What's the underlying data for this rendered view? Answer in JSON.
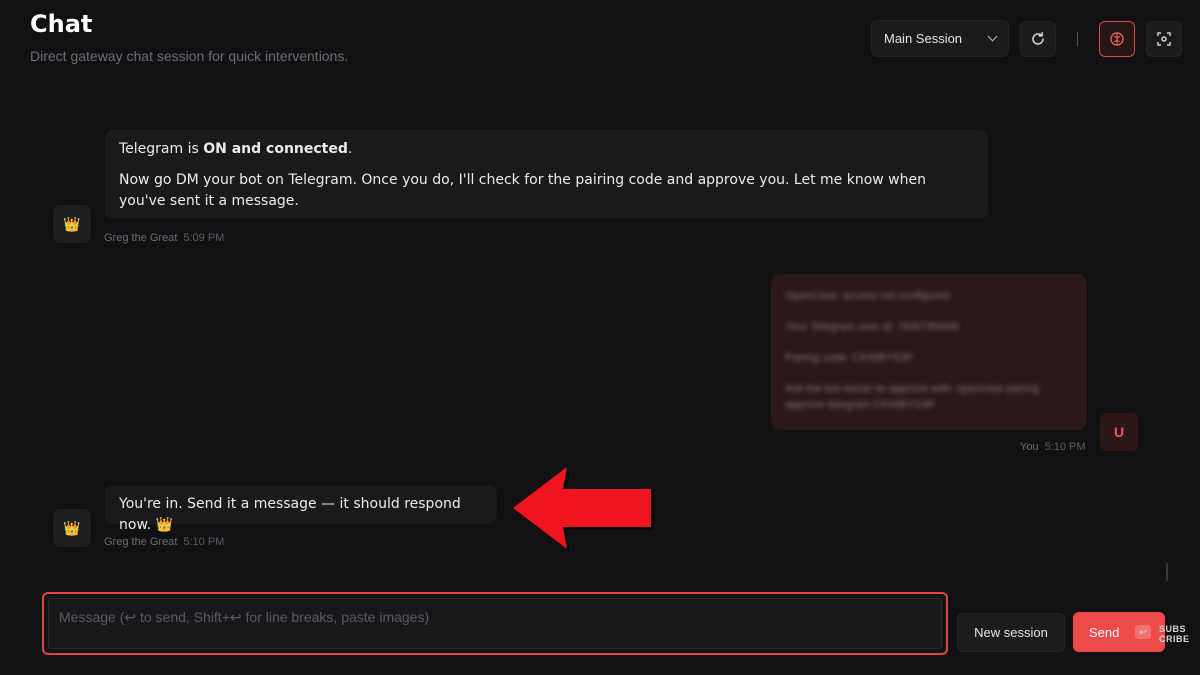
{
  "header": {
    "title": "Chat",
    "subtitle": "Direct gateway chat session for quick interventions."
  },
  "toolbar": {
    "session_select": "Main Session",
    "icons": [
      "refresh-icon",
      "brain-icon",
      "focus-icon"
    ]
  },
  "messages": [
    {
      "sender": "Greg the Great",
      "time": "5:09 PM",
      "avatar": "👑",
      "line1_prefix": "Telegram is ",
      "line1_bold": "ON and connected",
      "line1_suffix": ".",
      "line2": "Now go DM your bot on Telegram. Once you do, I'll check for the pairing code and approve you. Let me know when you've sent it a message."
    },
    {
      "sender": "You",
      "time": "5:10 PM",
      "avatar": "U",
      "blurred_lines": [
        "OpenClaw: access not configured.",
        "Your Telegram user id: 7830785696",
        "Pairing code: CKWBYS3P",
        "Ask the bot owner to approve with: openclaw pairing approve telegram CKWBYS3P"
      ]
    },
    {
      "sender": "Greg the Great",
      "time": "5:10 PM",
      "avatar": "👑",
      "text": "You're in. Send it a message — it should respond now. 👑"
    }
  ],
  "composer": {
    "placeholder": "Message (↩ to send, Shift+↩ for line breaks, paste images)",
    "new_session_label": "New session",
    "send_label": "Send",
    "send_kbd": "↩"
  },
  "overlay": {
    "subscribe_line1": "SUBS",
    "subscribe_line2": "CRIBE"
  },
  "colors": {
    "background": "#111113",
    "accent": "#ee4a4a",
    "arrow": "#f0141e"
  }
}
